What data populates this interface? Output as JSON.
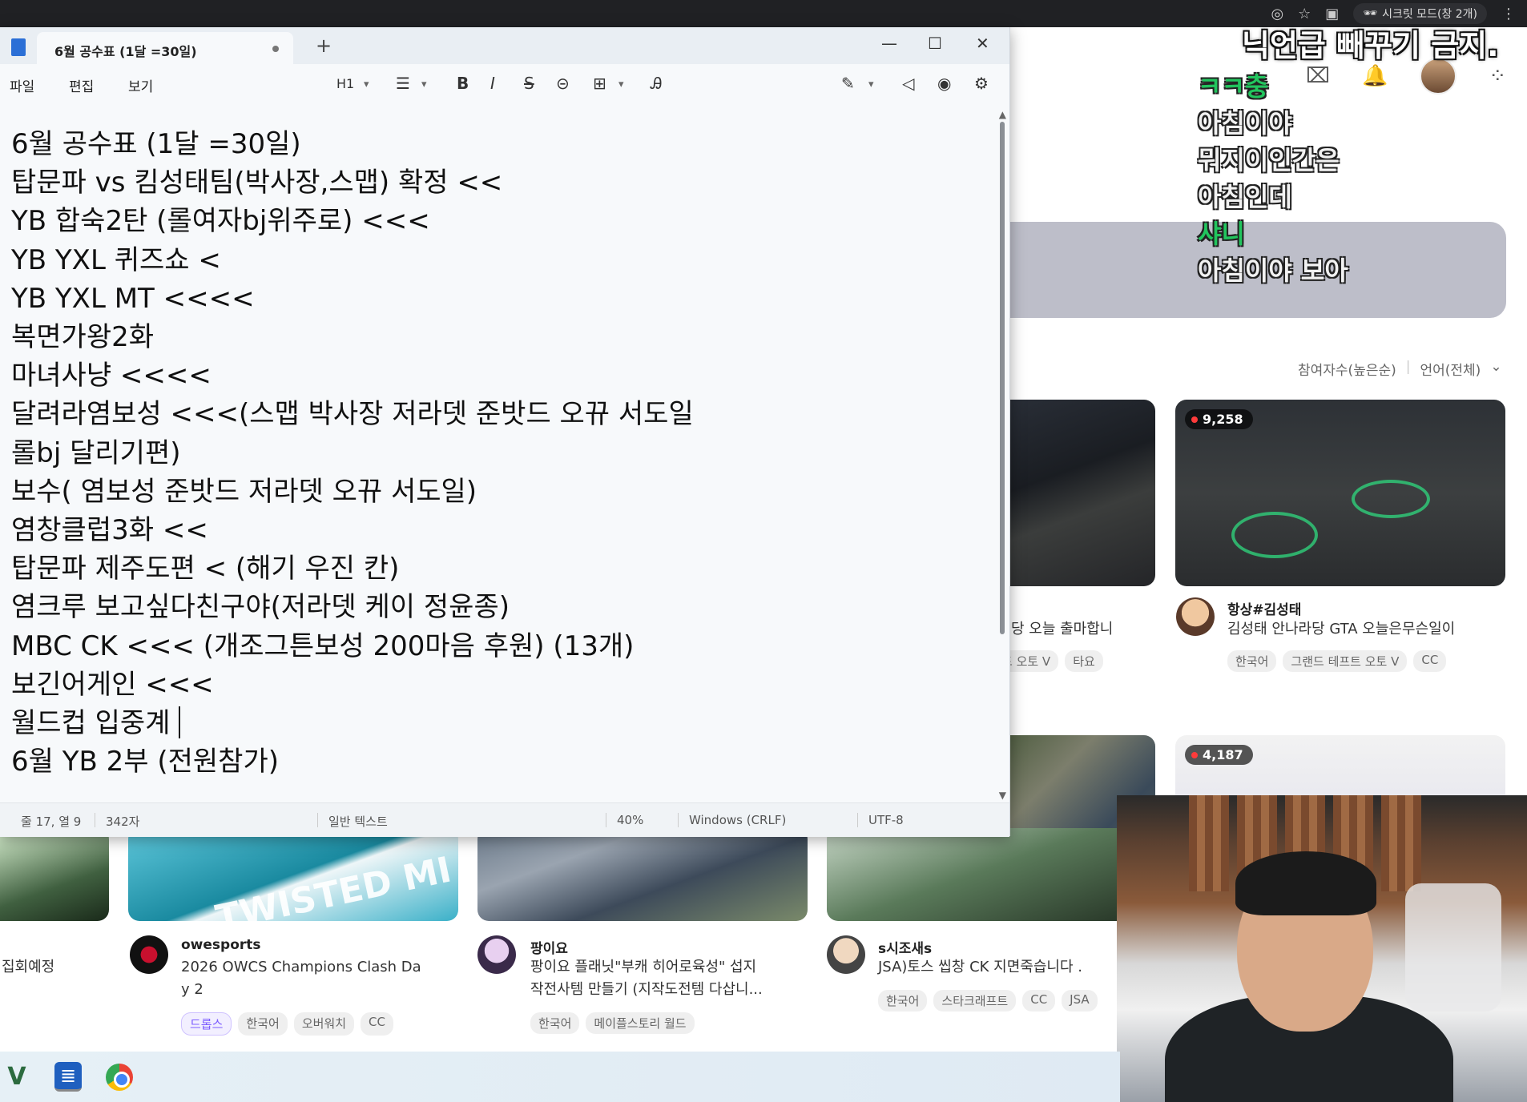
{
  "browser": {
    "incognito_label": "시크릿 모드(창 2개)",
    "overlay_title": "닉언급 빼꾸기 금지."
  },
  "chat": [
    {
      "text": "ㅋㅋ충",
      "color": "#22c55e"
    },
    {
      "text": "아침이야",
      "color": "#f2f2f2"
    },
    {
      "text": "뭐지이인간은",
      "color": "#f2f2f2"
    },
    {
      "text": "아침인데",
      "color": "#f2f2f2"
    },
    {
      "text": "샤니",
      "color": "#22c55e"
    },
    {
      "text": "아침이야 보아",
      "color": "#f2f2f2"
    }
  ],
  "filters": {
    "sort": "참여자수(높은순)",
    "language": "언어(전체)"
  },
  "cards": {
    "top_left": {
      "title_partial": "당 오늘 출마합니",
      "tags": [
        "드 오토 V",
        "타요"
      ]
    },
    "top_right": {
      "viewers": "9,258",
      "channel": "항상#김성태",
      "title": "김성태 안나라당 GTA 오늘은무슨일이",
      "tags": [
        "한국어",
        "그랜드 테프트 오토 V",
        "CC"
      ]
    },
    "mid_right": {
      "viewers": "4,187"
    },
    "bottom_far_left": {
      "title_partial": "집회예정"
    },
    "bottom_ow": {
      "channel": "owesports",
      "title_line1": "2026 OWCS Champions Clash Da",
      "title_line2": "y 2",
      "tags": [
        "드롭스",
        "한국어",
        "오버워치",
        "CC"
      ],
      "thumb_text": "TWISTED MI"
    },
    "bottom_maple": {
      "channel": "팡이요",
      "title_line1": "팡이요 플래닛\"부캐 히어로육성\" 섭지",
      "title_line2": "작전사템 만들기 (지작도전템 다삽니...",
      "tags": [
        "한국어",
        "메이플스토리 월드"
      ]
    },
    "bottom_sc": {
      "channel": "s시조새s",
      "title": "JSA)토스 씹창 CK 지면죽습니다 .",
      "tags": [
        "한국어",
        "스타크래프트",
        "CC",
        "JSA"
      ]
    }
  },
  "notepad": {
    "tab_title": "6월 공수표 (1달 =30일)",
    "menu": [
      "파일",
      "편집",
      "보기"
    ],
    "toolbar": {
      "heading": "H1"
    },
    "lines": [
      "6월 공수표 (1달 =30일)",
      "",
      "탑문파 vs 킴성태팀(박사장,스맵) 확정 <<",
      "YB 합숙2탄 (롤여자bj위주로) <<<",
      "YB YXL 퀴즈쇼 <",
      "YB YXL MT <<<<",
      "복면가왕2화",
      "마녀사냥 <<<<",
      "달려라염보성 <<<(스맵 박사장 저라뎃 준밧드 오뀨 서도일",
      "롤bj 달리기편)",
      "보수( 염보성 준밧드 저라뎃 오뀨 서도일)",
      "염창클럽3화 <<",
      "탑문파 제주도편 < (해기 우진 칸)",
      "염크루 보고싶다친구야(저라뎃 케이 정윤종)",
      "MBC CK <<< (개조그튼보성 200마음 후원) (13개)",
      "보긴어게인 <<<",
      "월드컵 입중계",
      "6월 YB 2부 (전원참가)"
    ],
    "status": {
      "position": "줄 17, 열 9",
      "chars": "342자",
      "format": "일반 텍스트",
      "zoom": "40%",
      "line_ending": "Windows (CRLF)",
      "encoding": "UTF-8"
    }
  }
}
